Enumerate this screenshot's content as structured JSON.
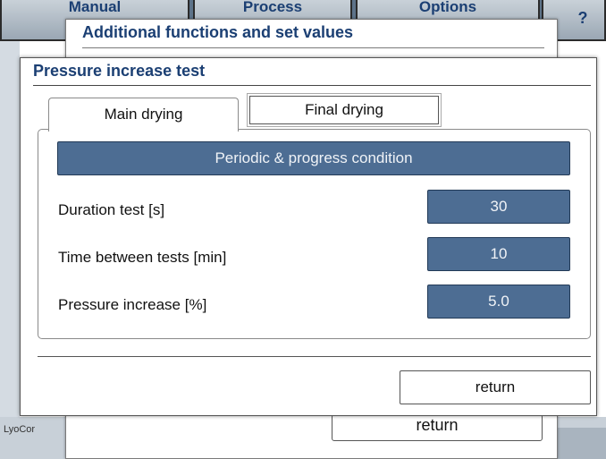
{
  "background": {
    "top_tabs": [
      {
        "label": "Manual"
      },
      {
        "label": "Process"
      },
      {
        "label": "Options"
      },
      {
        "label": "?"
      }
    ],
    "footer_text": "LyoCor"
  },
  "mid_dialog": {
    "title": "Additional functions and set values",
    "return_label": "return"
  },
  "dialog": {
    "title": "Pressure increase test",
    "tabs": [
      {
        "label": "Main drying",
        "active": true
      },
      {
        "label": "Final drying",
        "active": false
      }
    ],
    "section_header": "Periodic & progress condition",
    "rows": [
      {
        "label": "Duration test [s]",
        "value": "30"
      },
      {
        "label": "Time between tests [min]",
        "value": "10"
      },
      {
        "label": "Pressure increase [%]",
        "value": "5.0"
      }
    ],
    "return_label": "return"
  },
  "colors": {
    "accent": "#4d6d93",
    "title": "#1b3f73",
    "background": "#5d7389"
  }
}
